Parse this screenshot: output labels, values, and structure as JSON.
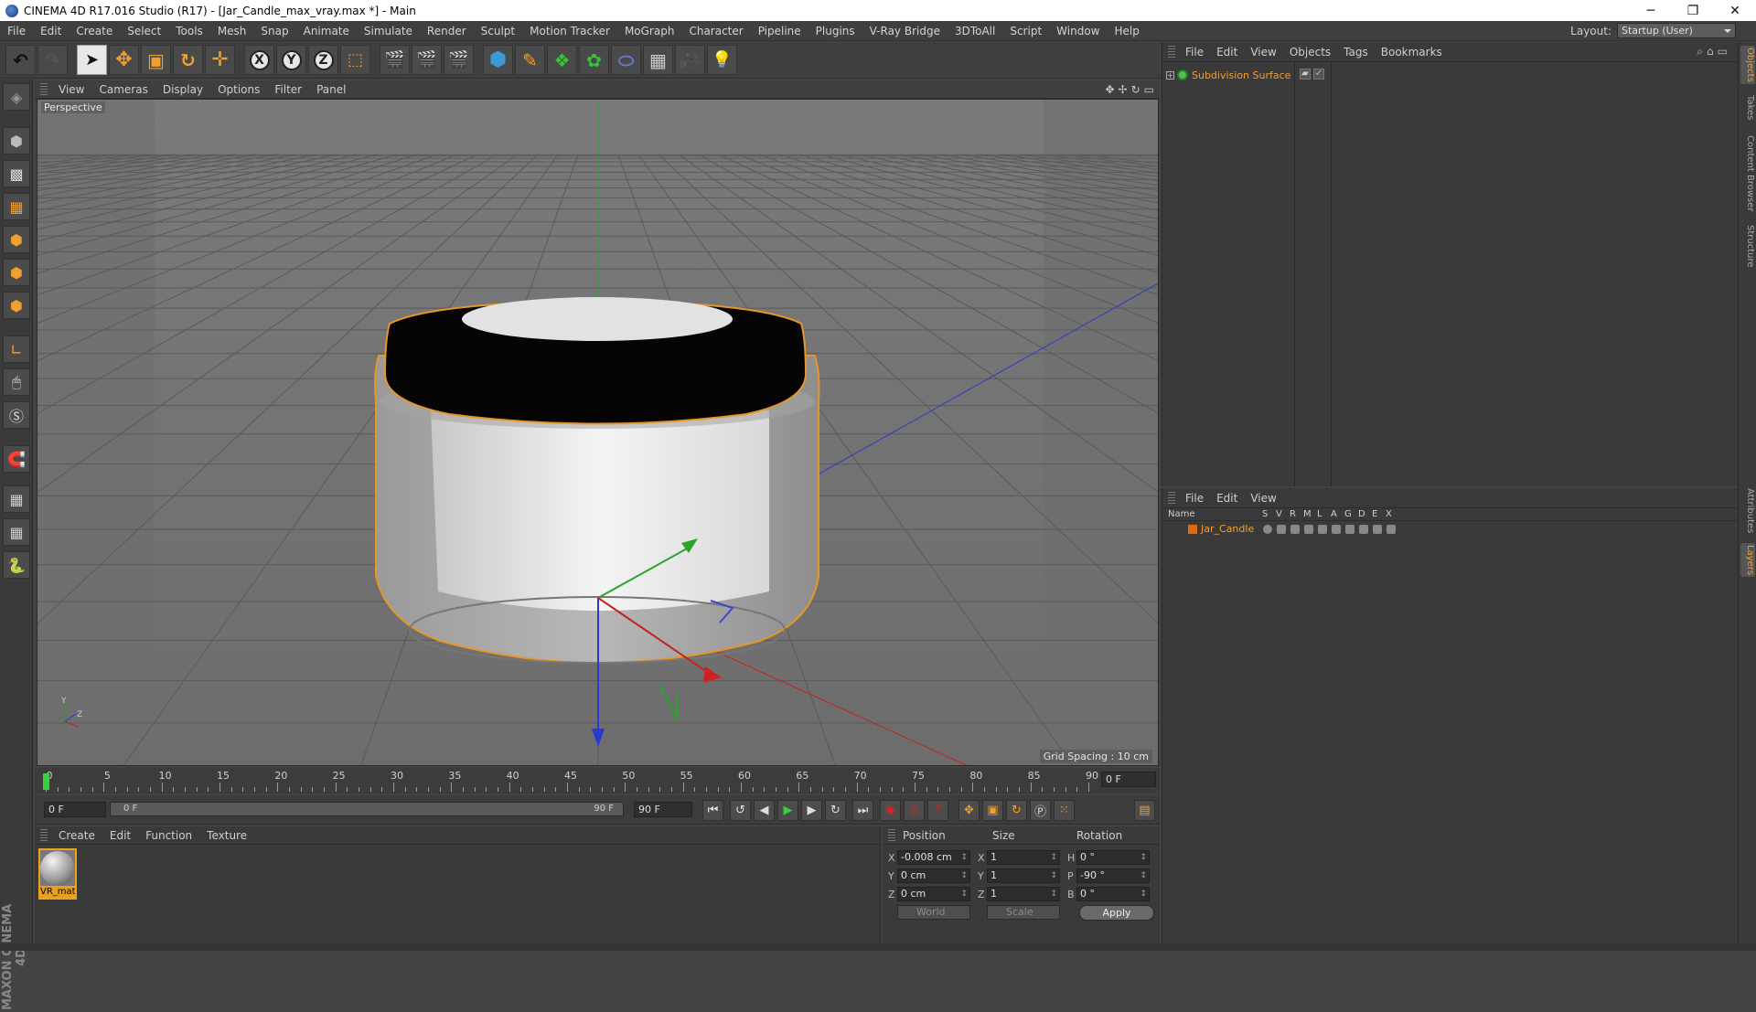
{
  "window": {
    "title": "CINEMA 4D R17.016 Studio (R17) - [Jar_Candle_max_vray.max *] - Main",
    "controls": {
      "minimize": "─",
      "restore": "❐",
      "close": "✕"
    }
  },
  "menubar": {
    "items": [
      "File",
      "Edit",
      "Create",
      "Select",
      "Tools",
      "Mesh",
      "Snap",
      "Animate",
      "Simulate",
      "Render",
      "Sculpt",
      "Motion Tracker",
      "MoGraph",
      "Character",
      "Pipeline",
      "Plugins",
      "V-Ray Bridge",
      "3DToAll",
      "Script",
      "Window",
      "Help"
    ],
    "layout_label": "Layout:",
    "layout_value": "Startup (User)"
  },
  "toolbar": {
    "axis_x": "X",
    "axis_y": "Y",
    "axis_z": "Z"
  },
  "viewport": {
    "menu": [
      "View",
      "Cameras",
      "Display",
      "Options",
      "Filter",
      "Panel"
    ],
    "camera_label": "Perspective",
    "grid_spacing": "Grid Spacing : 10 cm",
    "nav_icons": [
      "✥",
      "✢",
      "↻",
      "▭"
    ],
    "axis_gizmo": {
      "y": "Y",
      "z": "Z"
    }
  },
  "timeline": {
    "ticks": [
      0,
      5,
      10,
      15,
      20,
      25,
      30,
      35,
      40,
      45,
      50,
      55,
      60,
      65,
      70,
      75,
      80,
      85,
      90
    ],
    "current_frame": "0 F",
    "start_field": "0 F",
    "range_start": "0 F",
    "range_end": "90 F",
    "end_field": "90 F"
  },
  "playback": {
    "icons": [
      "⏮",
      "↺",
      "◀",
      "▶",
      "▶",
      "↻",
      "⏭"
    ]
  },
  "material_panel": {
    "menu": [
      "Create",
      "Edit",
      "Function",
      "Texture"
    ],
    "material_name": "VR_mat"
  },
  "coord_panel": {
    "headers": {
      "position": "Position",
      "size": "Size",
      "rotation": "Rotation"
    },
    "rows": [
      {
        "pos_axis": "X",
        "pos": "-0.008 cm",
        "size_axis": "X",
        "size": "1",
        "rot_axis": "H",
        "rot": "0 °"
      },
      {
        "pos_axis": "Y",
        "pos": "0 cm",
        "size_axis": "Y",
        "size": "1",
        "rot_axis": "P",
        "rot": "-90 °"
      },
      {
        "pos_axis": "Z",
        "pos": "0 cm",
        "size_axis": "Z",
        "size": "1",
        "rot_axis": "B",
        "rot": "0 °"
      }
    ],
    "space_select": "World",
    "mode_select": "Scale",
    "apply": "Apply"
  },
  "object_manager": {
    "menu": [
      "File",
      "Edit",
      "View",
      "Objects",
      "Tags",
      "Bookmarks"
    ],
    "objects": [
      {
        "name": "Subdivision Surface",
        "expand": "+"
      }
    ],
    "tag_check": "✓"
  },
  "layer_manager": {
    "menu": [
      "File",
      "Edit",
      "View"
    ],
    "columns": [
      "Name",
      "S",
      "V",
      "R",
      "M",
      "L",
      "A",
      "G",
      "D",
      "E",
      "X"
    ],
    "layers": [
      {
        "name": "Jar_Candle"
      }
    ]
  },
  "side_tabs": {
    "top": [
      "Objects",
      "Takes",
      "Content Browser",
      "Structure"
    ],
    "bottom": [
      "Attributes",
      "Layers"
    ]
  },
  "maxon_logo": "MAXON CINEMA 4D",
  "colors": {
    "accent_orange": "#f0a030",
    "selection_outline": "#e8952a",
    "axis_x": "#d02020",
    "axis_y": "#20a020",
    "axis_z": "#2040d0"
  }
}
